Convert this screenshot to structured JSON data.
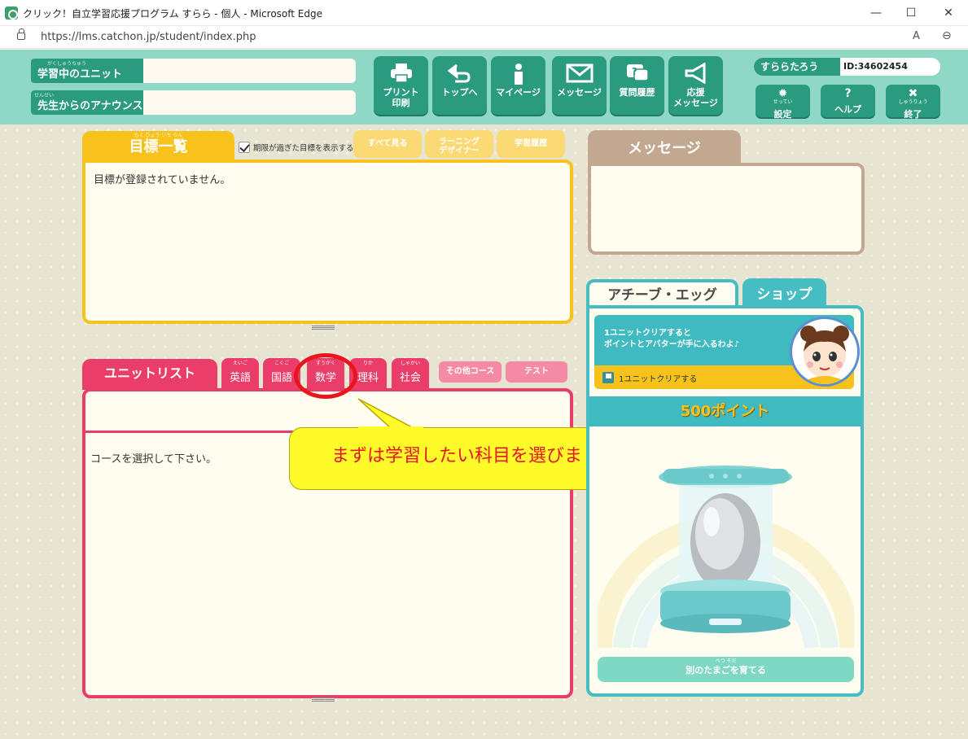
{
  "browser": {
    "title": "クリック！自立学習応援プログラム すらら - 個人 - Microsoft Edge",
    "url": "https://lms.catchon.jp/student/index.php",
    "minimize": "—",
    "maximize": "☐",
    "close": "✕",
    "read_aloud": "A",
    "zoom": "⊖"
  },
  "header": {
    "unit_label": "学習中のユニット",
    "unit_ruby": "がくしゅうちゅう",
    "announce_label": "先生からのアナウンス",
    "announce_ruby": "せんせい",
    "nav": [
      {
        "label": "プリント",
        "label2": "印刷",
        "icon": "printer-icon"
      },
      {
        "label": "トップへ",
        "label2": "",
        "icon": "back-arrow-icon"
      },
      {
        "label": "マイページ",
        "label2": "",
        "icon": "person-icon"
      },
      {
        "label": "メッセージ",
        "label2": "",
        "icon": "envelope-icon"
      },
      {
        "label": "質問履歴",
        "label2": "",
        "icon": "question-bubble-icon"
      },
      {
        "label": "応援",
        "label2": "メッセージ",
        "icon": "megaphone-icon"
      }
    ],
    "user_name": "すららたろう",
    "user_id": "ID:34602454",
    "settings_label": "設定",
    "settings_ruby": "せってい",
    "help_label": "ヘルプ",
    "exit_label": "終了",
    "exit_ruby": "しゅうりょう"
  },
  "goals": {
    "tab_label": "目標一覧",
    "tab_ruby": "もく ひょう いち らん",
    "show_expired_label": "期限が過ぎた目標を表示する",
    "show_all": "すべて見る",
    "learning_designer_1": "ラーニング",
    "learning_designer_2": "デザイナー",
    "history": "学習履歴",
    "empty_text": "目標が登録されていません。"
  },
  "units": {
    "tab_label": "ユニットリスト",
    "subjects": [
      {
        "label": "英語",
        "ruby": "えいご"
      },
      {
        "label": "国語",
        "ruby": "こくご"
      },
      {
        "label": "数学",
        "ruby": "すうがく"
      },
      {
        "label": "理科",
        "ruby": "りか"
      },
      {
        "label": "社会",
        "ruby": "しゃかい"
      }
    ],
    "other_course": "その他コース",
    "test": "テスト",
    "empty_text": "コースを選択して下さい。"
  },
  "callout": {
    "text": "まずは学習したい科目を選びましょう"
  },
  "messages": {
    "tab_label": "メッセージ"
  },
  "egg": {
    "tab_achieve": "アチーブ・エッグ",
    "tab_shop": "ショップ",
    "banner_line1": "1ユニットクリアすると",
    "banner_line2": "ポイントとアバターが手に入るわよ♪",
    "banner_task": "1ユニットクリアする",
    "points": "500ポイント",
    "other_egg_button": "別のたまごを育てる",
    "other_egg_ruby": "べつ                そだ"
  }
}
